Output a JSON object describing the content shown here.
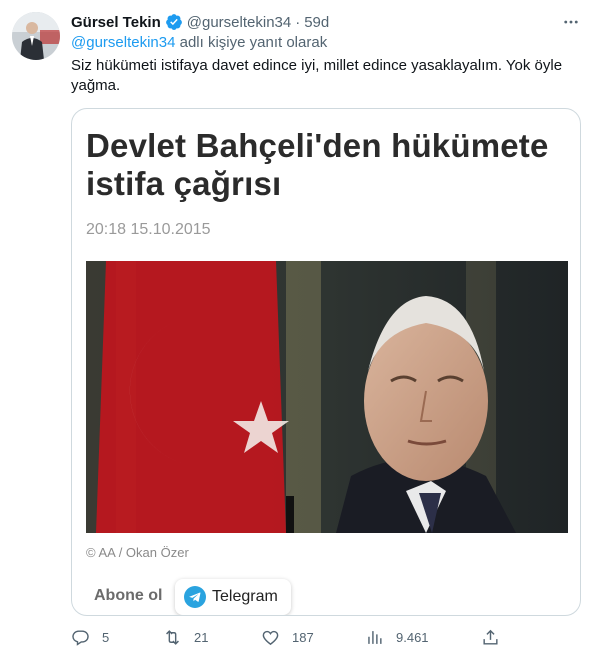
{
  "tweet": {
    "author_name": "Gürsel Tekin",
    "author_handle": "@gurseltekin34",
    "separator": "·",
    "time": "59d",
    "reply_mention": "@gurseltekin34",
    "reply_suffix": " adlı kişiye yanıt olarak",
    "text": "Siz hükümeti istifaya davet edince iyi, millet edince yasaklayalım. Yok öyle yağma.",
    "verified_color": "#1d9bf0",
    "accent_color": "#1d9bf0"
  },
  "card": {
    "headline": "Devlet Bahçeli'den hükümete istifa çağrısı",
    "date": "20:18 15.10.2015",
    "photo_credit": "© AA / Okan Özer",
    "subscribe_label": "Abone ol",
    "telegram_label": "Telegram",
    "telegram_color": "#2aa3df"
  },
  "actions": {
    "replies": "5",
    "retweets": "21",
    "likes": "187",
    "views": "9.461"
  }
}
